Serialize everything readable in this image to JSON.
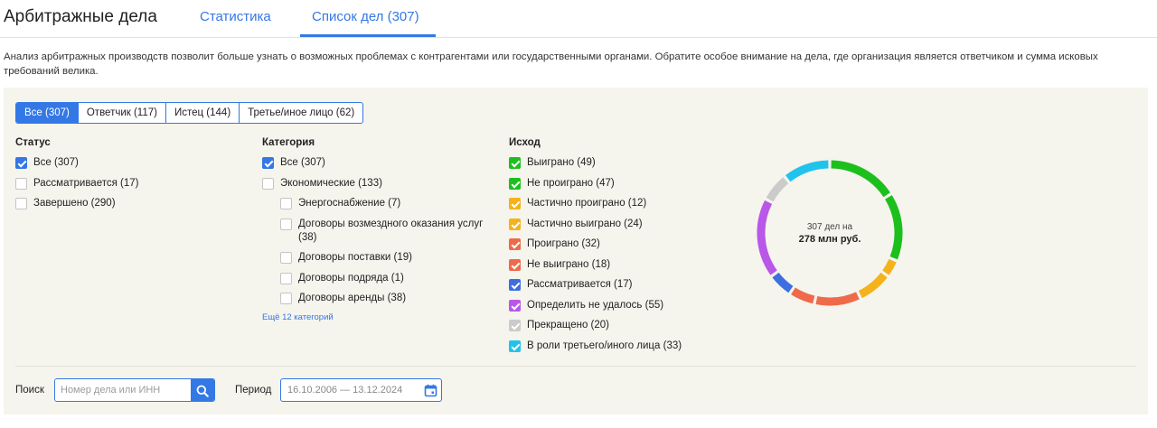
{
  "header": {
    "title": "Арбитражные дела",
    "tabs": [
      {
        "label": "Статистика",
        "active": false
      },
      {
        "label": "Список дел (307)",
        "active": true
      }
    ]
  },
  "description": "Анализ арбитражных производств позволит больше узнать о возможных проблемах с контрагентами или государственными органами. Обратите особое внимание на дела, где организация является ответчиком и сумма исковых требований велика.",
  "filter_tabs": [
    {
      "label": "Все (307)",
      "active": true
    },
    {
      "label": "Ответчик (117)",
      "active": false
    },
    {
      "label": "Истец (144)",
      "active": false
    },
    {
      "label": "Третье/иное лицо (62)",
      "active": false
    }
  ],
  "status": {
    "heading": "Статус",
    "items": [
      {
        "label": "Все (307)",
        "checked": true
      },
      {
        "label": "Рассматривается (17)",
        "checked": false
      },
      {
        "label": "Завершено (290)",
        "checked": false
      }
    ]
  },
  "category": {
    "heading": "Категория",
    "items": [
      {
        "label": "Все (307)",
        "checked": true,
        "level": 0
      },
      {
        "label": "Экономические (133)",
        "checked": false,
        "level": 0
      },
      {
        "label": "Энергоснабжение (7)",
        "checked": false,
        "level": 1
      },
      {
        "label": "Договоры возмездного оказания услуг (38)",
        "checked": false,
        "level": 1
      },
      {
        "label": "Договоры поставки (19)",
        "checked": false,
        "level": 1
      },
      {
        "label": "Договоры подряда (1)",
        "checked": false,
        "level": 1
      },
      {
        "label": "Договоры аренды (38)",
        "checked": false,
        "level": 1
      }
    ],
    "more_link": "Ещё 12 категорий"
  },
  "outcome": {
    "heading": "Исход",
    "items": [
      {
        "label": "Выиграно (49)",
        "value": 49,
        "color": "#1dbf1d",
        "checked": true
      },
      {
        "label": "Не проиграно (47)",
        "value": 47,
        "color": "#1dbf1d",
        "checked": true
      },
      {
        "label": "Частично проиграно (12)",
        "value": 12,
        "color": "#f4b21b",
        "checked": true
      },
      {
        "label": "Частично выиграно (24)",
        "value": 24,
        "color": "#f4b21b",
        "checked": true
      },
      {
        "label": "Проиграно (32)",
        "value": 32,
        "color": "#ef6a4a",
        "checked": true
      },
      {
        "label": "Не выиграно (18)",
        "value": 18,
        "color": "#ef6a4a",
        "checked": true
      },
      {
        "label": "Рассматривается (17)",
        "value": 17,
        "color": "#3d6fe0",
        "checked": true
      },
      {
        "label": "Определить не удалось (55)",
        "value": 55,
        "color": "#b957e8",
        "checked": true
      },
      {
        "label": "Прекращено (20)",
        "value": 20,
        "color": "#cbcbcb",
        "checked": true
      },
      {
        "label": "В роли третьего/иного лица (33)",
        "value": 33,
        "color": "#21c3ec",
        "checked": true
      }
    ]
  },
  "donut": {
    "line1": "307 дел на",
    "line2": "278 млн руб."
  },
  "search": {
    "label": "Поиск",
    "placeholder": "Номер дела или ИНН"
  },
  "period": {
    "label": "Период",
    "value": "16.10.2006 — 13.12.2024"
  },
  "colors": {
    "accent": "#3478e5",
    "panel_bg": "#f5f4ed"
  },
  "icons": {
    "search": "search-icon",
    "calendar": "calendar-icon"
  }
}
